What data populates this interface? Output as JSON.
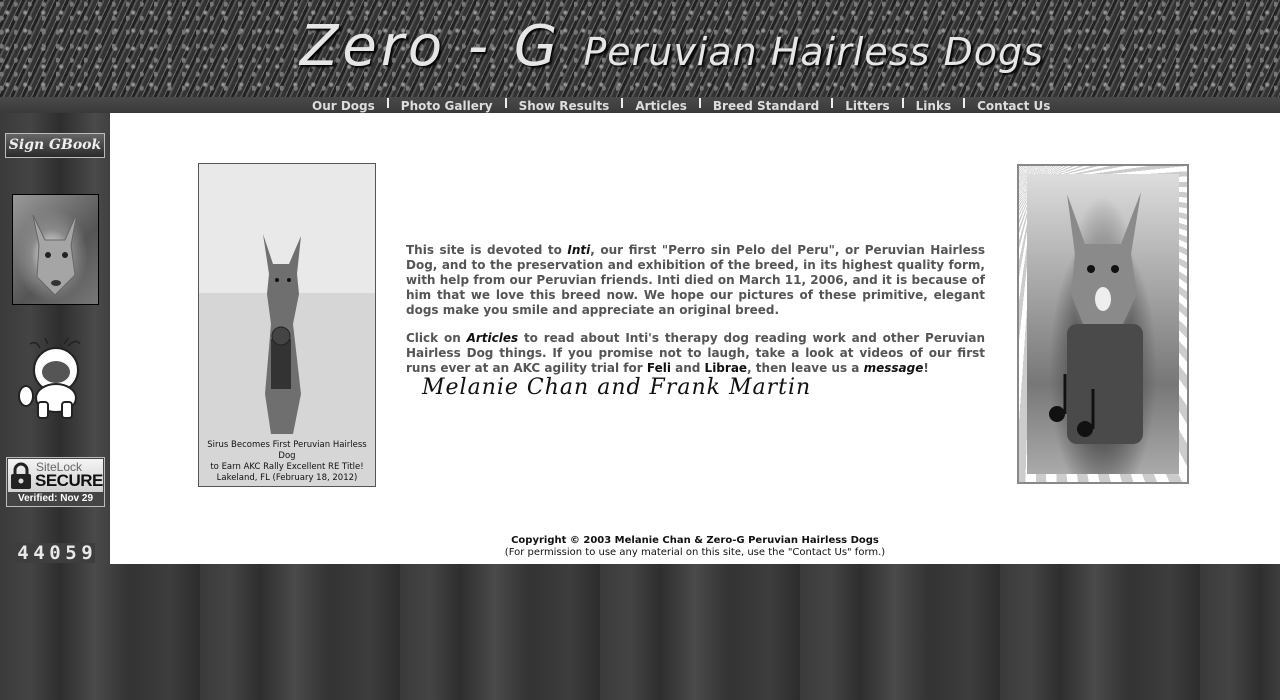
{
  "header": {
    "title_main": "Zero - G",
    "title_sub": "Peruvian Hairless Dogs"
  },
  "nav": {
    "items": [
      {
        "label": "Our Dogs"
      },
      {
        "label": "Photo Gallery"
      },
      {
        "label": "Show Results"
      },
      {
        "label": "Articles"
      },
      {
        "label": "Breed Standard"
      },
      {
        "label": "Litters"
      },
      {
        "label": "Links"
      },
      {
        "label": "Contact Us"
      }
    ]
  },
  "sidebar": {
    "guestbook_label": "Sign GBook",
    "sitelock": {
      "name": "SiteLock",
      "secure": "SECURE",
      "verified": "Verified: Nov 29"
    },
    "counter_digits": [
      "4",
      "4",
      "0",
      "5",
      "9"
    ]
  },
  "main": {
    "left_photo_caption": [
      "Sirus Becomes First Peruvian Hairless Dog",
      "to Earn AKC Rally Excellent RE Title!",
      "Lakeland, FL (February 18, 2012)"
    ],
    "intro": {
      "p1_a": "This site is devoted to ",
      "p1_inti": "Inti",
      "p1_b": ", our first \"Perro sin Pelo del Peru\", or Peruvian Hairless Dog, and to the preservation and exhibition of the breed, in its highest quality form, with help from our Peruvian friends. Inti died on March 11, 2006, and it is because of him that we love this breed now. We hope our pictures of these primitive, elegant dogs make you smile and appreciate an original breed.",
      "p2_a": "Click on ",
      "p2_articles": "Articles",
      "p2_b": " to read about Inti's therapy dog reading work and other Peruvian Hairless Dog things. If you promise not to laugh, take a look at videos of our first runs ever at an AKC agility trial for ",
      "p2_feli": "Feli",
      "p2_and": " and ",
      "p2_librae": "Librae",
      "p2_c": ", then leave us a ",
      "p2_message": "message",
      "p2_end": "!"
    },
    "signature": "Melanie Chan  and  Frank Martin"
  },
  "footer": {
    "copyright": "Copyright © 2003 Melanie Chan & Zero-G Peruvian Hairless Dogs",
    "permission": "(For permission to use any material on this site, use the \"Contact Us\" form.)"
  }
}
